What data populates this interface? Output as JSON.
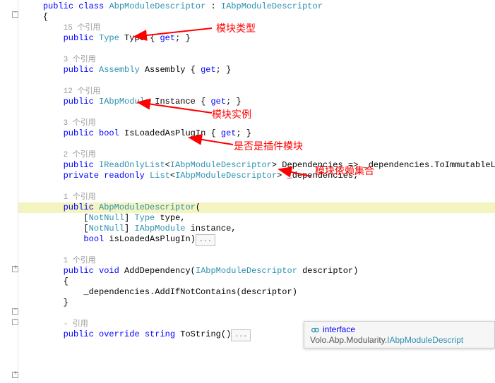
{
  "refs": {
    "r15": "15 个引用",
    "r3a": "3 个引用",
    "r12": "12 个引用",
    "r3b": "3 个引用",
    "r2": "2 个引用",
    "r1a": "1 个引用",
    "r1b": "1 个引用",
    "rDash": "- 引用"
  },
  "kw": {
    "public": "public",
    "class": "class",
    "private": "private",
    "readonly": "readonly",
    "bool": "bool",
    "void": "void",
    "override": "override",
    "string": "string",
    "get": "get"
  },
  "type": {
    "Type": "Type",
    "Assembly": "Assembly",
    "IAbpModule": "IAbpModule",
    "IReadOnlyList": "IReadOnlyList",
    "IAbpModuleDescriptor": "IAbpModuleDescriptor",
    "List": "List",
    "AbpModuleDescriptor": "AbpModuleDescriptor",
    "NotNull": "NotNull"
  },
  "ident": {
    "Type": "Type",
    "Assembly": "Assembly",
    "Instance": "Instance",
    "IsLoadedAsPlugIn": "IsLoadedAsPlugIn",
    "Dependencies": "Dependencies",
    "_dependencies": "_dependencies",
    "ToImmutableList": "ToImmutableList",
    "type": "type",
    "instance": "instance",
    "isLoadedAsPlugIn": "isLoadedAsPlugIn",
    "AddDependency": "AddDependency",
    "descriptor": "descriptor",
    "AddIfNotContains": "AddIfNotContains",
    "ToString": "ToString"
  },
  "ellipsis": "...",
  "ann": {
    "a1": "模块类型",
    "a2": "模块实例",
    "a3": "是否是插件模块",
    "a4": "模块依赖集合"
  },
  "tooltip": {
    "kind": "interface",
    "ns": "Volo.Abp.Modularity.",
    "name": "IAbpModuleDescript"
  },
  "chart_data": null
}
